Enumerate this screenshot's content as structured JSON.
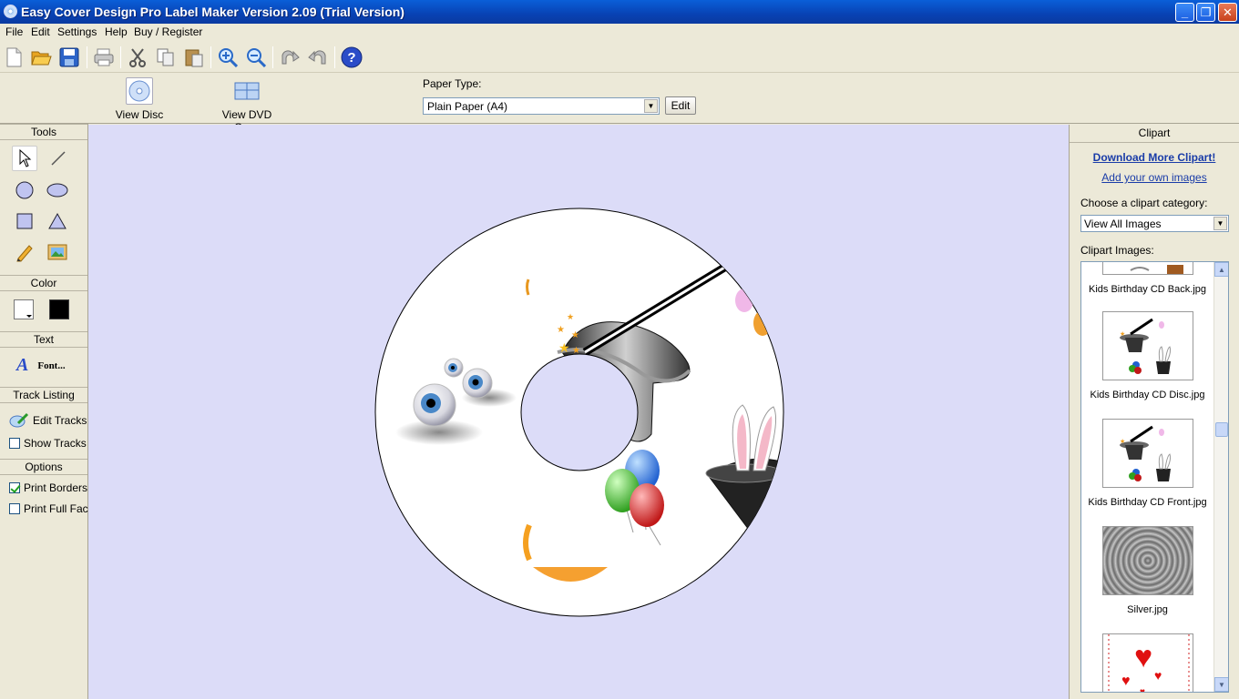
{
  "window": {
    "title": "Easy Cover Design Pro Label Maker Version 2.09 (Trial Version)",
    "minimize": "_",
    "restore": "❐",
    "close": "✕"
  },
  "menu": [
    "File",
    "Edit",
    "Settings",
    "Help",
    "Buy / Register"
  ],
  "toolbar": {
    "icons": [
      "new-icon",
      "open-folder-icon",
      "save-icon",
      "print-icon",
      "cut-icon",
      "copy-icon",
      "paste-icon",
      "zoom-in-icon",
      "zoom-out-icon",
      "redo-icon",
      "undo-icon",
      "help-icon"
    ]
  },
  "views": {
    "disc": "View Disc",
    "dvd_case": "View DVD Case"
  },
  "paper": {
    "label": "Paper Type:",
    "value": "Plain Paper (A4)",
    "edit": "Edit"
  },
  "left_panel": {
    "tools": "Tools",
    "color": "Color",
    "text": "Text",
    "font": "Font...",
    "track_listing": "Track Listing",
    "edit_tracks": "Edit Tracks",
    "show_tracks": "Show Tracks",
    "options": "Options",
    "print_borders": "Print Borders",
    "print_full_face": "Print Full Face",
    "print_borders_checked": true,
    "print_full_face_checked": false,
    "show_tracks_checked": false,
    "fill_color": "#ffffff",
    "line_color": "#000000"
  },
  "clipart": {
    "header": "Clipart",
    "download_more": "Download More Clipart!",
    "add_own": "Add your own images",
    "category_label": "Choose a clipart category:",
    "category_value": "View All Images",
    "images_label": "Clipart Images:",
    "items": [
      "Kids Birthday CD Back.jpg",
      "Kids Birthday CD Disc.jpg",
      "Kids Birthday CD Front.jpg",
      "Silver.jpg"
    ]
  },
  "colors": {
    "canvas_bg": "#dcdcf8",
    "link": "#1a3ca8"
  }
}
